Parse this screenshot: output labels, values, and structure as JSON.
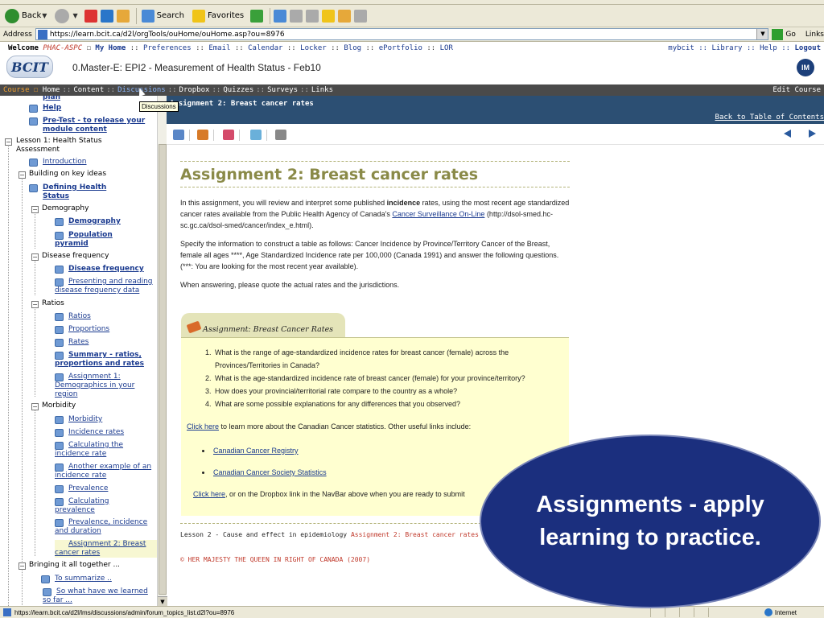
{
  "browser": {
    "toolbar": {
      "back_label": "Back",
      "search_label": "Search",
      "favorites_label": "Favorites"
    },
    "address_label": "Address",
    "address_value": "https://learn.bcit.ca/d2l/orgTools/ouHome/ouHome.asp?ou=8976",
    "go_label": "Go",
    "links_label": "Links",
    "status_url": "https://learn.bcit.ca/d2l/lms/discussions/admin/forum_topics_list.d2l?ou=8976",
    "zone_label": "Internet"
  },
  "header": {
    "welcome_label": "Welcome",
    "org_label": "PHAC-ASPC",
    "my_home": "My Home",
    "links": [
      "Preferences",
      "Email",
      "Calendar",
      "Locker",
      "Blog",
      "ePortfolio",
      "LOR"
    ],
    "right_links": [
      "Library",
      "Help"
    ],
    "logout": "Logout",
    "logo_text": "BCIT",
    "mybcit": "mybcit",
    "course_title": "0.Master-E: EPI2 - Measurement of Health Status - Feb10",
    "im_label": "IM"
  },
  "navbar": {
    "course_label": "Course",
    "items": [
      "Home",
      "Content",
      "Discussions",
      "Dropbox",
      "Quizzes",
      "Surveys",
      "Links"
    ],
    "edit_course": "Edit Course",
    "tooltip": "Discussions"
  },
  "tree": {
    "nodes": [
      {
        "text": "plan",
        "type": "link-bold"
      },
      {
        "text": "Help",
        "type": "link-bold"
      },
      {
        "text": "Pre-Test - to release your module content",
        "type": "link-bold"
      },
      {
        "text": "Lesson 1: Health Status Assessment",
        "type": "folder"
      },
      {
        "text": "Introduction",
        "type": "link"
      },
      {
        "text": "Building on key ideas",
        "type": "folder"
      },
      {
        "text": "Defining Health Status",
        "type": "link-bold"
      },
      {
        "text": "Demography",
        "type": "folder"
      },
      {
        "text": "Demography",
        "type": "link-bold"
      },
      {
        "text": "Population pyramid",
        "type": "link-bold"
      },
      {
        "text": "Disease frequency",
        "type": "folder"
      },
      {
        "text": "Disease frequency",
        "type": "link-bold"
      },
      {
        "text": "Presenting and reading disease frequency data",
        "type": "link"
      },
      {
        "text": "Ratios",
        "type": "folder"
      },
      {
        "text": "Ratios",
        "type": "link"
      },
      {
        "text": "Proportions",
        "type": "link"
      },
      {
        "text": "Rates",
        "type": "link"
      },
      {
        "text": "Summary - ratios, proportions and rates",
        "type": "link-bold"
      },
      {
        "text": "Assignment 1: Demographics in your region",
        "type": "link"
      },
      {
        "text": "Morbidity",
        "type": "folder"
      },
      {
        "text": "Morbidity",
        "type": "link"
      },
      {
        "text": "Incidence rates",
        "type": "link"
      },
      {
        "text": "Calculating the incidence rate",
        "type": "link"
      },
      {
        "text": "Another example of an incidence rate",
        "type": "link"
      },
      {
        "text": "Prevalence",
        "type": "link"
      },
      {
        "text": "Calculating prevalence",
        "type": "link"
      },
      {
        "text": "Prevalence, incidence and duration",
        "type": "link"
      },
      {
        "text": "Assignment 2: Breast cancer rates",
        "type": "link-current"
      },
      {
        "text": "Bringing it all together ...",
        "type": "folder"
      },
      {
        "text": "To summarize ..",
        "type": "link"
      },
      {
        "text": "So what have we learned so far ...",
        "type": "link"
      }
    ]
  },
  "content": {
    "header_title": "Assignment 2: Breast cancer rates",
    "back_to_toc": "Back to Table of Contents",
    "heading": "Assignment 2: Breast cancer rates",
    "intro_a": "In this assignment, you will review and interpret some published ",
    "intro_bold": "incidence",
    "intro_b": " rates, using the most recent age standardized cancer rates available from the Public Health Agency of Canada's ",
    "intro_link": "Cancer Surveillance On-Line",
    "intro_c": " (http://dsol-smed.hc-sc.gc.ca/dsol-smed/cancer/index_e.html).",
    "para2": "Specify the information to construct a table as follows: Cancer Incidence by Province/Territory Cancer of the Breast, female all ages ****, Age Standardized Incidence rate per 100,000 (Canada 1991) and answer the following questions. (***: You are looking for the most recent year available).",
    "para3": "When answering, please quote the actual rates and the jurisdictions.",
    "tab_label": "Assignment: Breast Cancer Rates",
    "questions": [
      "What is the range of age-standardized incidence rates for breast cancer (female) across the Provinces/Territories in Canada?",
      "What is the age-standardized incidence rate of breast cancer (female) for your province/territory?",
      "How does your provincial/territorial rate compare to the country as a whole?",
      "What are some possible explanations for any differences that you observed?"
    ],
    "click_here": "Click here",
    "more_text": " to learn more about the Canadian Cancer statistics. Other useful links include:",
    "useful_links": [
      "Canadian Cancer Registry",
      "Canadian Cancer Society Statistics"
    ],
    "submit_link": "Click here",
    "submit_text": ", or on the Dropbox link in the NavBar above when you are ready to submit",
    "footer_path": "Lesson 2 - Cause and effect in epidemiology",
    "footer_current": "Assignment 2: Breast cancer rates",
    "copyright": "© HER MAJESTY THE QUEEN IN RIGHT OF CANADA (2007)"
  },
  "callout": {
    "text": "Assignments - apply learning to practice."
  }
}
